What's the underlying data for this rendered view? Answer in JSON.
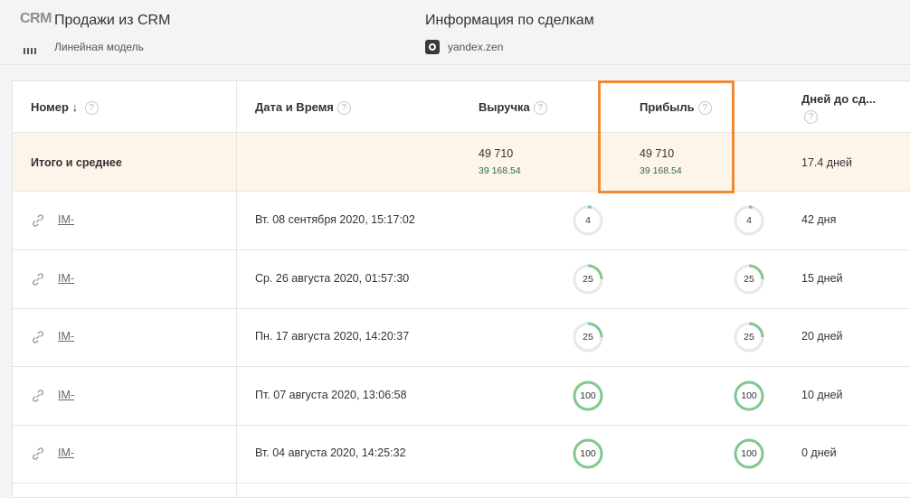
{
  "header": {
    "logo": "CRM",
    "source_title": "Продажи из CRM",
    "model_label": "Линейная модель",
    "info_title": "Информация по сделкам",
    "zen_label": "yandex.zen"
  },
  "table": {
    "columns": {
      "number": "Номер",
      "sort_arrow": "↓",
      "datetime": "Дата и Время",
      "revenue": "Выручка",
      "profit": "Прибыль",
      "days": "Дней до сд..."
    },
    "help_glyph": "?",
    "totals": {
      "label": "Итого и среднее",
      "revenue": "49 710",
      "revenue_sub": "39 168.54",
      "profit": "49 710",
      "profit_sub": "39 168.54",
      "days": "17.4 дней"
    },
    "rows": [
      {
        "id": "IM-",
        "datetime": "Вт. 08 сентября 2020, 15:17:02",
        "revenue_pct": 4,
        "profit_pct": 4,
        "days": "42 дня"
      },
      {
        "id": "IM-",
        "datetime": "Ср. 26 августа 2020, 01:57:30",
        "revenue_pct": 25,
        "profit_pct": 25,
        "days": "15 дней"
      },
      {
        "id": "IM-",
        "datetime": "Пн. 17 августа 2020, 14:20:37",
        "revenue_pct": 25,
        "profit_pct": 25,
        "days": "20 дней"
      },
      {
        "id": "IM-",
        "datetime": "Пт. 07 августа 2020, 13:06:58",
        "revenue_pct": 100,
        "profit_pct": 100,
        "days": "10 дней"
      },
      {
        "id": "IM-",
        "datetime": "Вт. 04 августа 2020, 14:25:32",
        "revenue_pct": 100,
        "profit_pct": 100,
        "days": "0 дней"
      }
    ]
  },
  "colors": {
    "accent_green": "#7fc98e",
    "track_gray": "#e8e8e8",
    "totals_bg": "#fdf5e9",
    "highlight_orange": "#f08a33"
  }
}
